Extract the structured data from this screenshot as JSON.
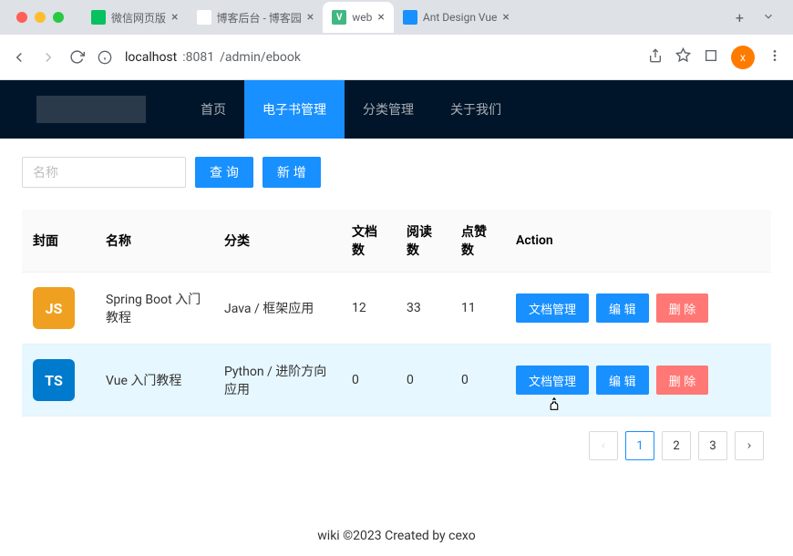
{
  "browser": {
    "tabs": [
      {
        "title": "微信网页版",
        "icon_bg": "#07c160",
        "icon_text": ""
      },
      {
        "title": "博客后台 - 博客园",
        "icon_bg": "#fff",
        "icon_text": ""
      },
      {
        "title": "web",
        "icon_bg": "#41b883",
        "icon_text": "V",
        "active": true
      },
      {
        "title": "Ant Design Vue",
        "icon_bg": "#1890ff",
        "icon_text": ""
      }
    ],
    "url_host": "localhost",
    "url_port": ":8081",
    "url_path": "/admin/ebook",
    "user_initial": "x"
  },
  "nav": {
    "items": [
      "首页",
      "电子书管理",
      "分类管理",
      "关于我们"
    ],
    "active_index": 1
  },
  "toolbar": {
    "search_placeholder": "名称",
    "query_label": "查 询",
    "add_label": "新 增"
  },
  "table": {
    "headers": [
      "封面",
      "名称",
      "分类",
      "文档数",
      "阅读数",
      "点赞数",
      "Action"
    ],
    "rows": [
      {
        "cover_text": "JS",
        "cover_class": "cover-js",
        "name": "Spring Boot 入门教程",
        "category": "Java / 框架应用",
        "docs": "12",
        "reads": "33",
        "likes": "11",
        "hover": false
      },
      {
        "cover_text": "TS",
        "cover_class": "cover-ts",
        "name": "Vue 入门教程",
        "category": "Python / 进阶方向应用",
        "docs": "0",
        "reads": "0",
        "likes": "0",
        "hover": true
      }
    ],
    "actions": {
      "doc_manage": "文档管理",
      "edit": "编 辑",
      "delete": "删 除"
    }
  },
  "pagination": {
    "pages": [
      "1",
      "2",
      "3"
    ],
    "active_index": 0
  },
  "footer": {
    "text": "wiki ©2023 Created by cexo"
  }
}
